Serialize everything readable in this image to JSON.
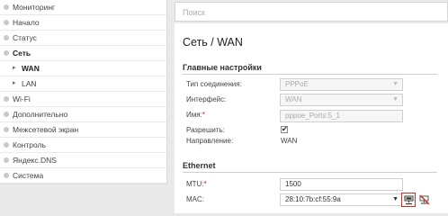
{
  "sidebar": {
    "items": [
      {
        "label": "Мониторинг",
        "kind": "group"
      },
      {
        "label": "Начало",
        "kind": "group"
      },
      {
        "label": "Статус",
        "kind": "group"
      },
      {
        "label": "Сеть",
        "kind": "open"
      },
      {
        "label": "WAN",
        "kind": "sub-active"
      },
      {
        "label": "LAN",
        "kind": "sub"
      },
      {
        "label": "Wi-Fi",
        "kind": "group"
      },
      {
        "label": "Дополнительно",
        "kind": "group"
      },
      {
        "label": "Межсетевой экран",
        "kind": "group"
      },
      {
        "label": "Контроль",
        "kind": "group"
      },
      {
        "label": "Яндекс.DNS",
        "kind": "group"
      },
      {
        "label": "Система",
        "kind": "group"
      }
    ]
  },
  "search": {
    "placeholder": "Поиск"
  },
  "page": {
    "title": "Сеть /  WAN"
  },
  "main_settings": {
    "heading": "Главные настройки",
    "connection_type_label": "Тип соединения:",
    "connection_type_value": "PPPoE",
    "interface_label": "Интерфейс:",
    "interface_value": "WAN",
    "name_label": "Имя:",
    "name_value": "pppoe_Ports:5_1",
    "enable_label": "Разрешить:",
    "enable_checked": true,
    "direction_label": "Направление:",
    "direction_value": "WAN"
  },
  "ethernet": {
    "heading": "Ethernet",
    "mtu_label": "MTU:",
    "mtu_value": "1500",
    "mac_label": "MAC:",
    "mac_value": "28:10:7b:cf:55:9a"
  },
  "icons": {
    "clone_mac": "clone-mac-icon",
    "clear_mac": "clear-mac-icon"
  },
  "colors": {
    "required": "#d9261c",
    "highlight": "#e0281e"
  }
}
